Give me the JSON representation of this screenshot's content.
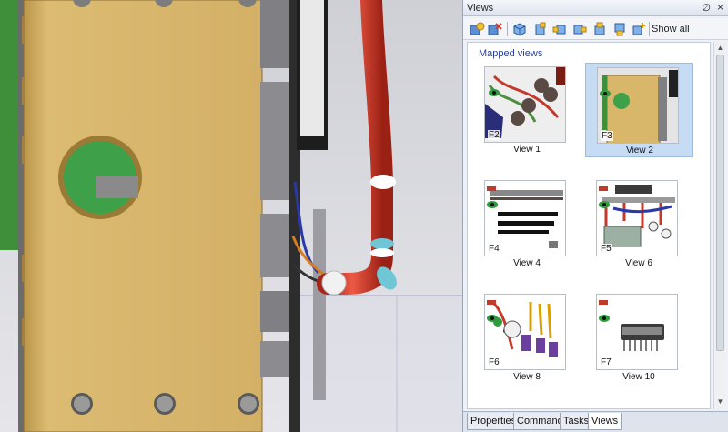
{
  "panel": {
    "title": "Views",
    "pin_icon": "pin-icon",
    "close_icon": "close-icon"
  },
  "toolbar": {
    "buttons": [
      {
        "icon": "map-view-icon"
      },
      {
        "icon": "delete-view-icon"
      },
      {
        "icon": "cube-front-icon"
      },
      {
        "icon": "cube-back-icon"
      },
      {
        "icon": "cube-left-icon"
      },
      {
        "icon": "cube-right-icon"
      },
      {
        "icon": "cube-top-icon"
      },
      {
        "icon": "cube-add-icon"
      }
    ],
    "show_all_label": "Show all"
  },
  "content": {
    "group_label": "Mapped views",
    "views": [
      {
        "key": "F2",
        "label": "View 1",
        "selected": false
      },
      {
        "key": "F3",
        "label": "View 2",
        "selected": true
      },
      {
        "key": "F4",
        "label": "View 4",
        "selected": false
      },
      {
        "key": "F5",
        "label": "View 6",
        "selected": false
      },
      {
        "key": "F6",
        "label": "View 8",
        "selected": false
      },
      {
        "key": "F7",
        "label": "View 10",
        "selected": false
      }
    ]
  },
  "tabs": [
    {
      "label": "Properties",
      "active": false
    },
    {
      "label": "Command",
      "active": false
    },
    {
      "label": "Tasks",
      "active": false
    },
    {
      "label": "Views",
      "active": true
    }
  ],
  "colors": {
    "board": "#d8b66a",
    "cable": "#d9402f",
    "selection": "#c6dcf5",
    "panel_bg": "#eef1f7"
  }
}
